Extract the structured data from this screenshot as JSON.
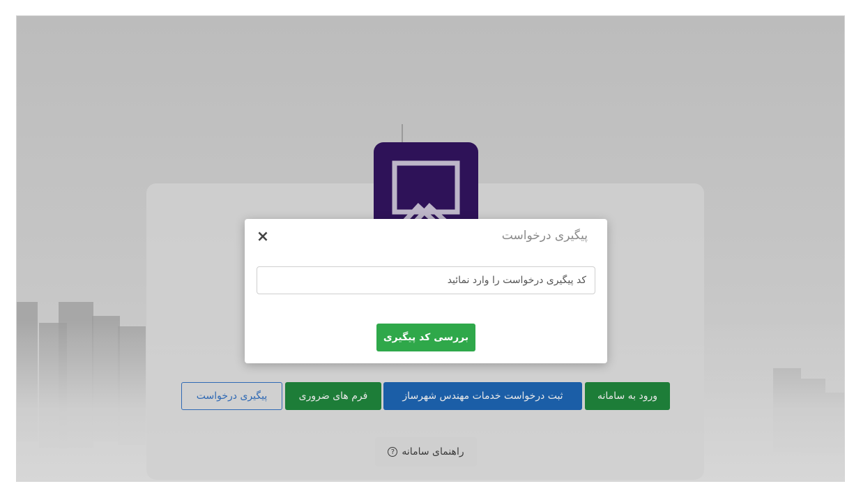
{
  "modal": {
    "title": "پیگیری درخواست",
    "close_icon": "×",
    "tracking_input": {
      "placeholder": "کد پیگیری درخواست را وارد نمائید",
      "value": ""
    },
    "check_button_label": "بررسی کد پیگیری"
  },
  "background": {
    "buttons": [
      {
        "label": "ورود به سامانه",
        "color": "#1d7d38"
      },
      {
        "label": "ثبت درخواست خدمات مهندس شهرساز",
        "color": "#1b5ea7"
      },
      {
        "label": "فرم های ضروری",
        "color": "#1d7d38"
      },
      {
        "label": "پیگیری درخواست",
        "color": "#2f69b4"
      }
    ],
    "guide_label": "راهنمای سامانه",
    "guide_icon": "question-circle-icon",
    "logo_color": "#2e1258"
  },
  "colors": {
    "primary_green": "#2fa84a",
    "overlay_gray": "#c4c4c4"
  }
}
